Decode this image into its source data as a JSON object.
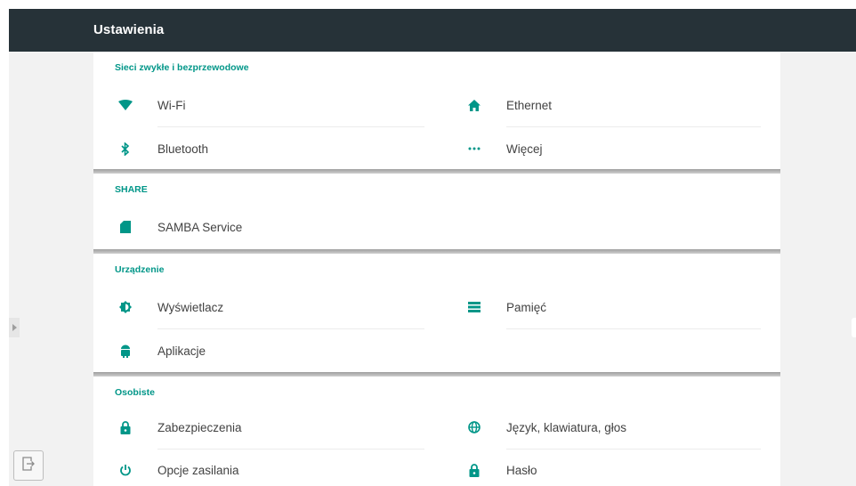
{
  "header": {
    "title": "Ustawienia"
  },
  "accent_color": "#009688",
  "sections": [
    {
      "title": "Sieci zwykłe i bezprzewodowe",
      "items": [
        {
          "label": "Wi-Fi",
          "icon": "wifi-icon"
        },
        {
          "label": "Ethernet",
          "icon": "home-icon"
        },
        {
          "label": "Bluetooth",
          "icon": "bluetooth-icon"
        },
        {
          "label": "Więcej",
          "icon": "more-icon"
        }
      ]
    },
    {
      "title": "SHARE",
      "items": [
        {
          "label": "SAMBA Service",
          "icon": "sd-card-icon"
        }
      ]
    },
    {
      "title": "Urządzenie",
      "items": [
        {
          "label": "Wyświetlacz",
          "icon": "brightness-icon"
        },
        {
          "label": "Pamięć",
          "icon": "storage-icon"
        },
        {
          "label": "Aplikacje",
          "icon": "android-icon"
        }
      ]
    },
    {
      "title": "Osobiste",
      "items": [
        {
          "label": "Zabezpieczenia",
          "icon": "lock-icon"
        },
        {
          "label": "Język, klawiatura, głos",
          "icon": "globe-icon"
        },
        {
          "label": "Opcje zasilania",
          "icon": "power-icon"
        },
        {
          "label": "Hasło",
          "icon": "lock-icon"
        }
      ]
    }
  ],
  "side_controls": {
    "left_arrow_icon": "chevron-right-icon",
    "exit_icon": "exit-icon"
  }
}
